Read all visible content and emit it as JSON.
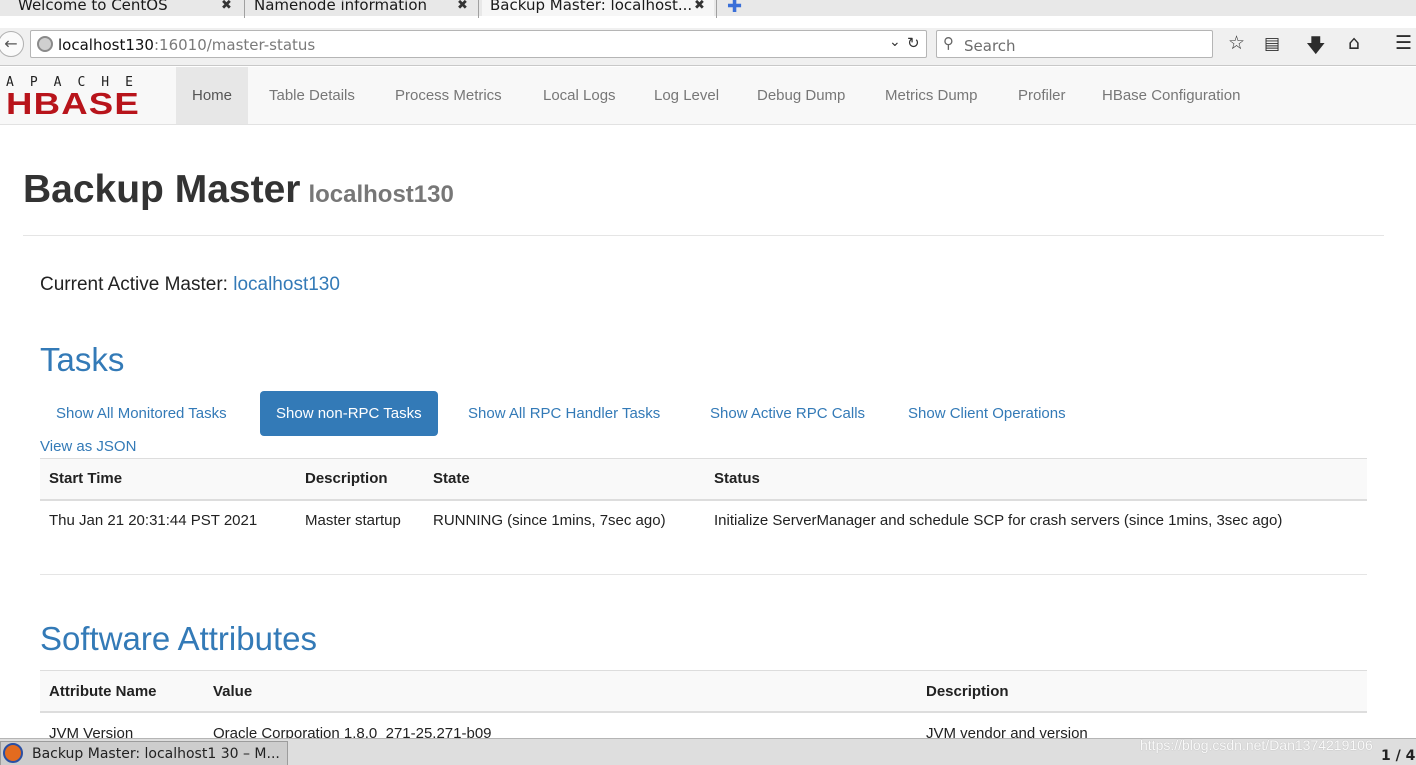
{
  "browser": {
    "tabs": [
      {
        "title": "Welcome to CentOS"
      },
      {
        "title": "Namenode information"
      },
      {
        "title": "Backup Master: localhost..."
      }
    ],
    "close_glyph": "✖",
    "new_tab_glyph": "✚",
    "url_host": "localhost130",
    "url_path": ":16010/master-status",
    "search_placeholder": "Search",
    "icons": [
      "back-icon",
      "globe-icon",
      "dropdown-icon",
      "reload-icon",
      "search-icon",
      "bookmark-star-icon",
      "reading-list-icon",
      "download-icon",
      "home-icon",
      "menu-icon"
    ]
  },
  "hbase_nav": {
    "logo_top": "APACHE",
    "logo_main": "HBASE",
    "items": [
      "Home",
      "Table Details",
      "Process Metrics",
      "Local Logs",
      "Log Level",
      "Debug Dump",
      "Metrics Dump",
      "Profiler",
      "HBase Configuration"
    ],
    "active": "Home"
  },
  "page": {
    "title": "Backup Master",
    "host": "localhost130",
    "active_master_label": "Current Active Master:",
    "active_master_link": "localhost130"
  },
  "tasks": {
    "heading": "Tasks",
    "pills": [
      "Show All Monitored Tasks",
      "Show non-RPC Tasks",
      "Show All RPC Handler Tasks",
      "Show Active RPC Calls",
      "Show Client Operations"
    ],
    "active_pill": "Show non-RPC Tasks",
    "view_json": "View as JSON",
    "columns": [
      "Start Time",
      "Description",
      "State",
      "Status"
    ],
    "rows": [
      [
        "Thu Jan 21 20:31:44 PST 2021",
        "Master startup",
        "RUNNING (since 1mins, 7sec ago)",
        "Initialize ServerManager and schedule SCP for crash servers (since 1mins, 3sec ago)"
      ]
    ]
  },
  "software": {
    "heading": "Software Attributes",
    "columns": [
      "Attribute Name",
      "Value",
      "Description"
    ],
    "rows": [
      [
        "JVM Version",
        "Oracle Corporation 1.8.0_271-25.271-b09",
        "JVM vendor and version"
      ]
    ]
  },
  "taskbar": {
    "item": "Backup Master: localhost1 30 – M...",
    "watermark": "https://blog.csdn.net/Dan1374219106",
    "pager": "1 / 4"
  },
  "colors": {
    "link": "#337ab7",
    "hbase_red": "#b8141b",
    "active_pill_bg": "#337ab7"
  }
}
